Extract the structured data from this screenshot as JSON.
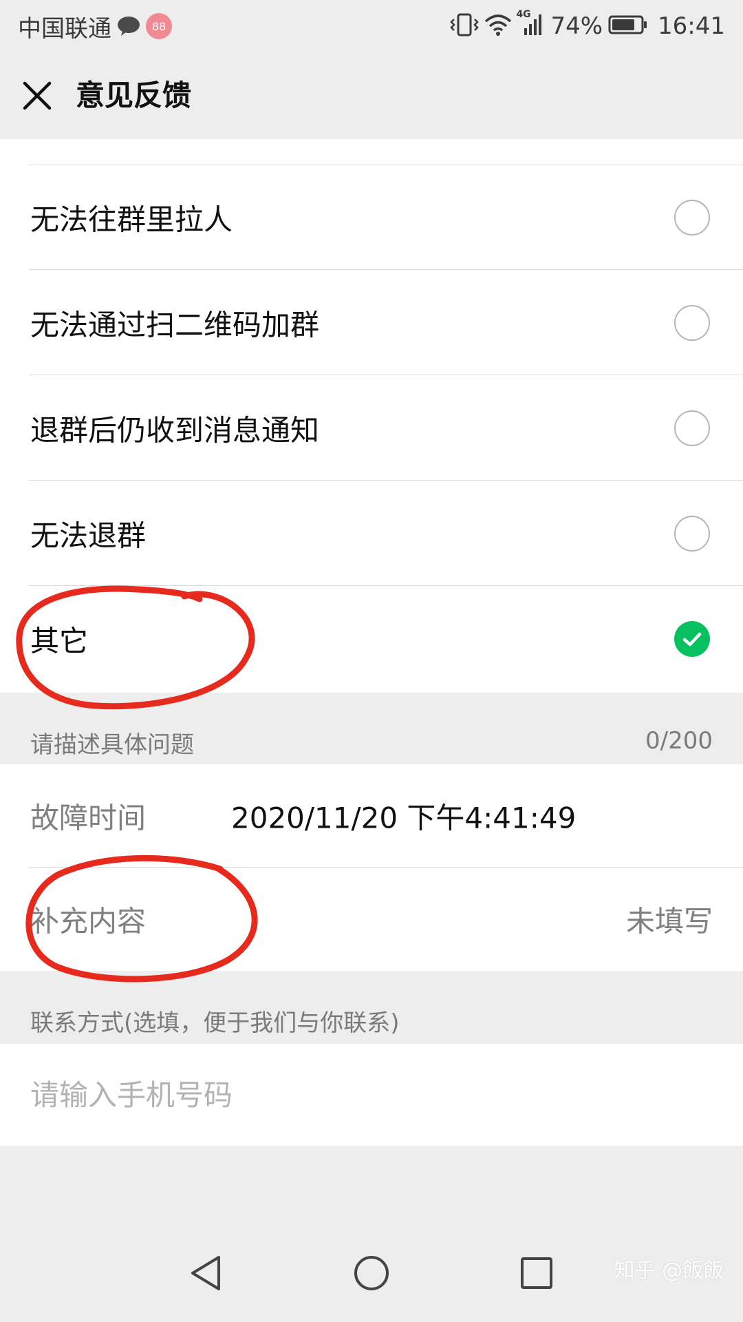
{
  "status_bar": {
    "carrier": "中国联通",
    "battery_percent": "74%",
    "time": "16:41",
    "network_label": "4G",
    "app_badge": "88"
  },
  "nav": {
    "title": "意见反馈",
    "close_icon": "close-icon"
  },
  "options": [
    {
      "label": "无法往群里拉人",
      "selected": false
    },
    {
      "label": "无法通过扫二维码加群",
      "selected": false
    },
    {
      "label": "退群后仍收到消息通知",
      "selected": false
    },
    {
      "label": "无法退群",
      "selected": false
    },
    {
      "label": "其它",
      "selected": true
    }
  ],
  "describe_section": {
    "label": "请描述具体问题",
    "counter": "0/200"
  },
  "details": {
    "fault_time_label": "故障时间",
    "fault_time_value": "2020/11/20 下午4:41:49",
    "extra_label": "补充内容",
    "extra_value": "未填写"
  },
  "contact": {
    "section_label": "联系方式(选填，便于我们与你联系)",
    "phone_placeholder": "请输入手机号码",
    "phone_value": ""
  },
  "watermark": "知乎 @飯飯",
  "colors": {
    "accent_green": "#07c160",
    "annotation_red": "#e62b1e",
    "background": "#ededed"
  }
}
